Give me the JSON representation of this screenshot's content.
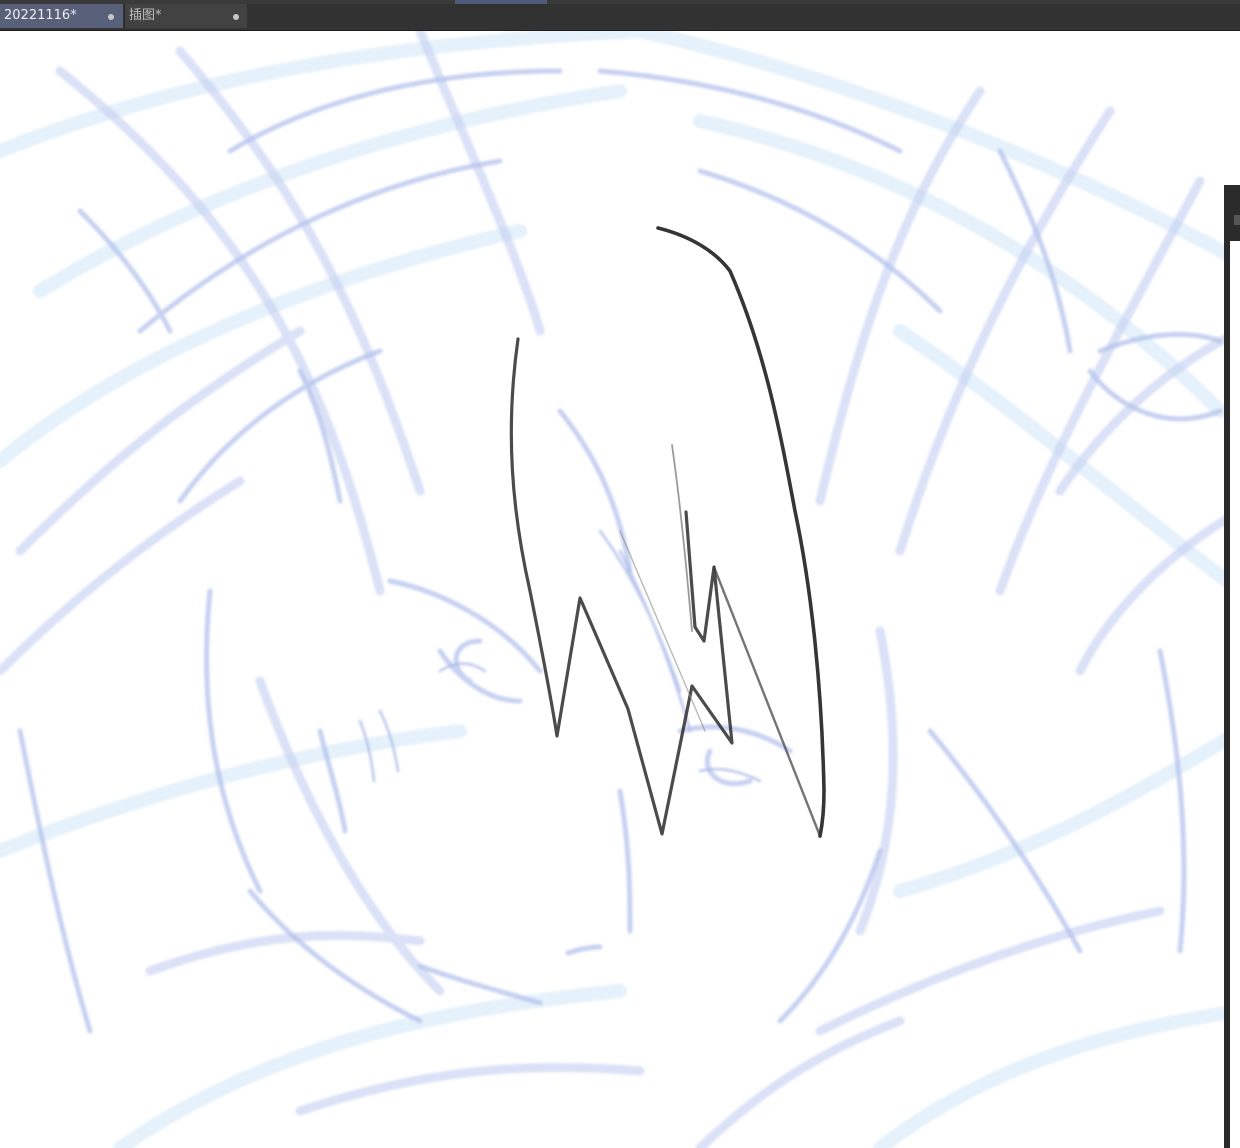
{
  "tabs": [
    {
      "label": "20221116*",
      "active": true
    },
    {
      "label": "插图*",
      "active": false
    }
  ],
  "colors": {
    "tab_active": "#596079",
    "tab_inactive": "#424242",
    "tabbar_bg": "#323232",
    "sketch_blue": "#b9c6ee",
    "sketch_light_blue": "#cfe6f8",
    "line_art": "#2a2a2a",
    "canvas_bg": "#ffffff"
  },
  "icons": {
    "tab_close": "dot-icon"
  }
}
